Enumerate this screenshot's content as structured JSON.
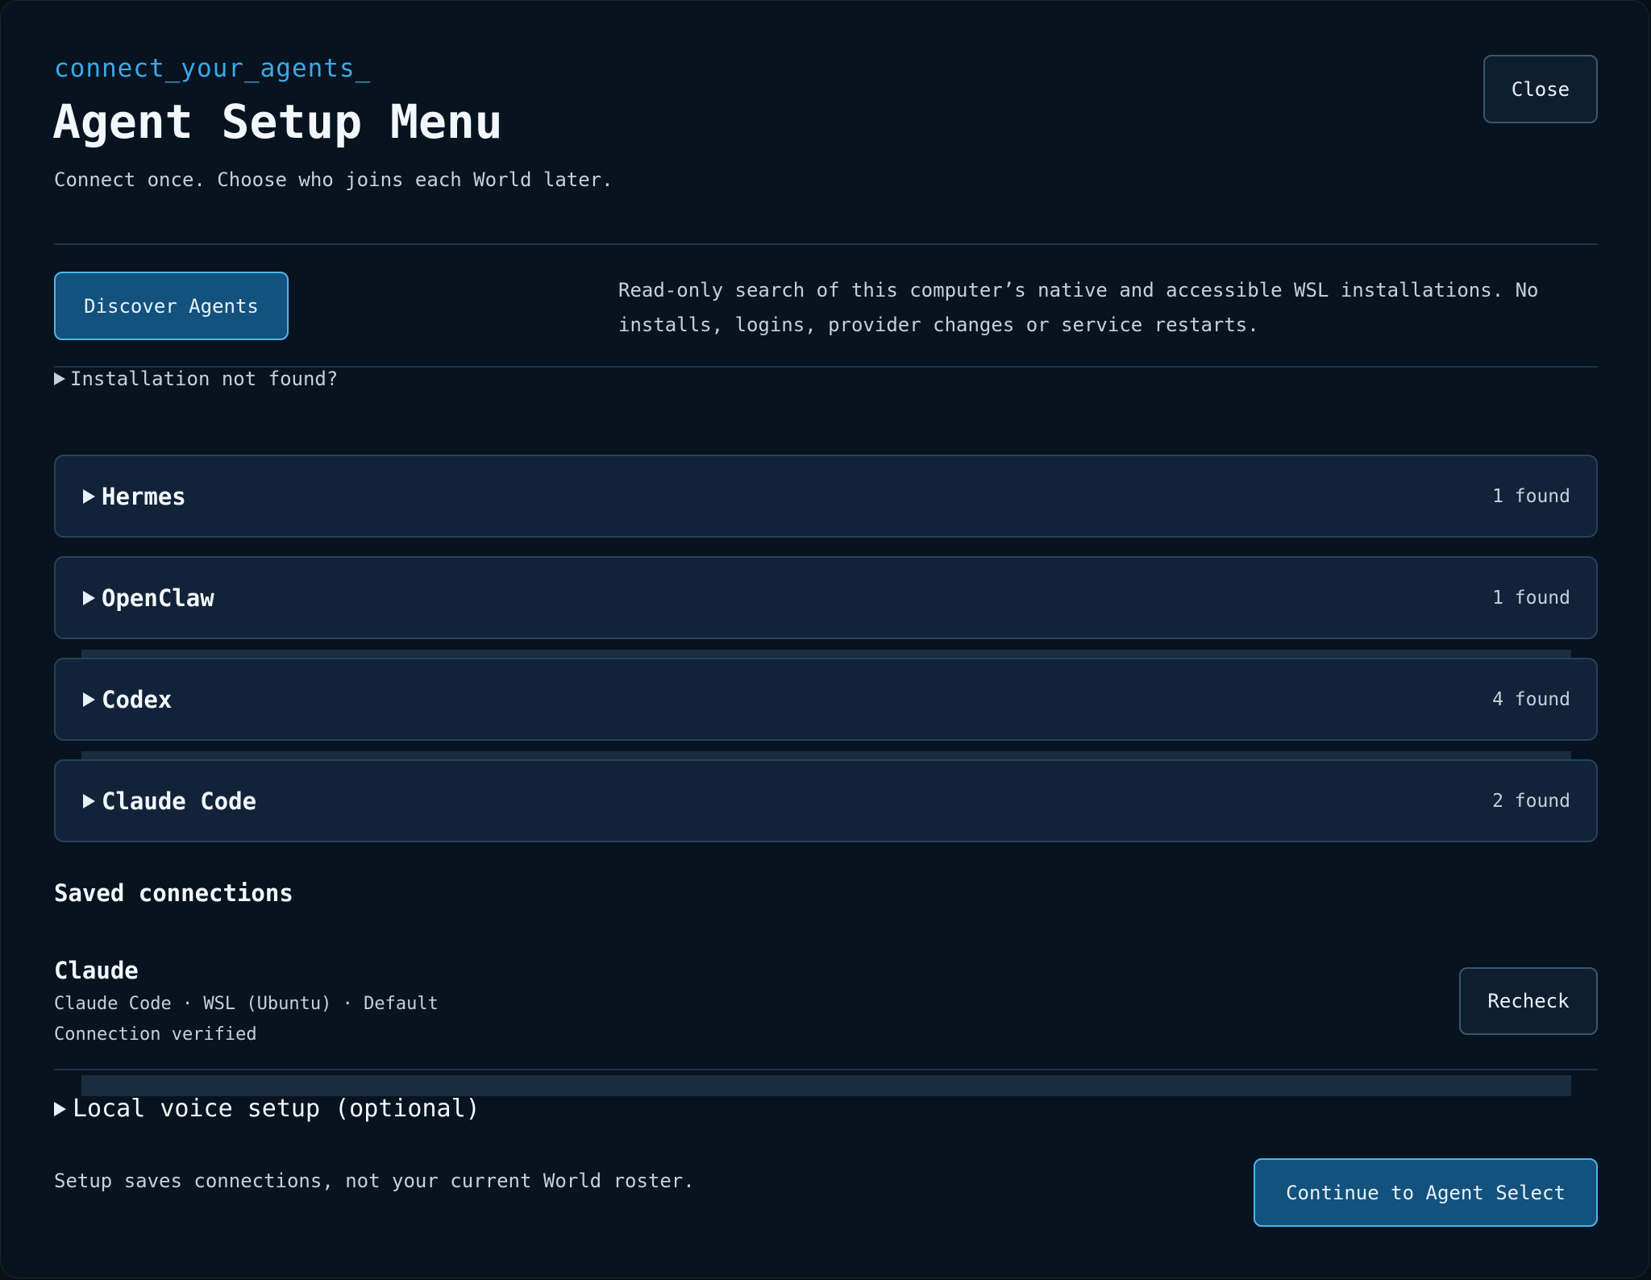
{
  "header": {
    "kicker": "connect_your_agents_",
    "title": "Agent Setup Menu",
    "subtitle": "Connect once. Choose who joins each World later.",
    "close_label": "Close"
  },
  "discover": {
    "button_label": "Discover Agents",
    "description": "Read-only search of this computer’s native and accessible WSL installations. No installs, logins, provider changes or service restarts.",
    "help_toggle": "Installation not found?"
  },
  "agents": [
    {
      "name": "Hermes",
      "count": "1 found"
    },
    {
      "name": "OpenClaw",
      "count": "1 found"
    },
    {
      "name": "Codex",
      "count": "4 found"
    },
    {
      "name": "Claude Code",
      "count": "2 found"
    }
  ],
  "saved": {
    "heading": "Saved connections",
    "connections": [
      {
        "name": "Claude",
        "detail": "Claude Code · WSL (Ubuntu) · Default",
        "status": "Connection verified",
        "action_label": "Recheck"
      }
    ]
  },
  "voice": {
    "toggle_label": "Local voice setup (optional)"
  },
  "footer": {
    "note": "Setup saves connections, not your current World roster.",
    "continue_label": "Continue to Agent Select"
  },
  "colors": {
    "accent": "#3ba9e6",
    "background": "#081320",
    "card": "#122238",
    "primary_button": "#12527c"
  },
  "icons": {
    "disclosure": "triangle-right-icon"
  }
}
